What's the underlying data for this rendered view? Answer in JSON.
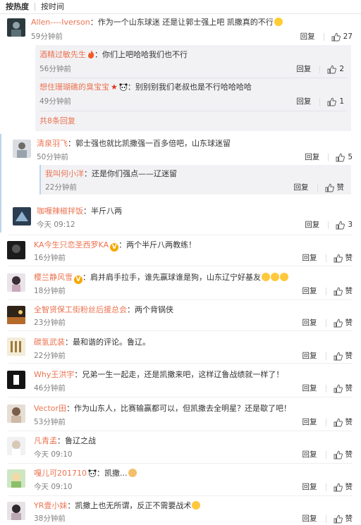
{
  "sort": {
    "hot": "按热度",
    "time": "按时间"
  },
  "labels": {
    "reply": "回复",
    "like": "赞"
  },
  "comments": [
    {
      "user": "Allen----Iverson",
      "text": "：作为一个山东球迷 还是让郭士强上吧 凯撒真的不行",
      "time": "59分钟前",
      "likes": "27",
      "replies": [
        {
          "user": "酒精过敏先生",
          "text": "：你们上吧哈哈我们也不行",
          "time": "56分钟前",
          "likes": "2"
        },
        {
          "user": "想住珊瑚礁的臭宝宝",
          "text": "：别别别我们老叔也是不行哈哈哈哈",
          "time": "49分钟前",
          "likes": "1"
        }
      ],
      "more": "共8条回复"
    },
    {
      "user": "清泉羽飞",
      "text": "：郭士强也就比凯撒强一百多倍吧，山东球迷留",
      "time": "50分钟前",
      "likes": "5",
      "replies": [
        {
          "user": "我叫何小洋",
          "text": "：还是你们强点——辽迷留",
          "time": "22分钟前",
          "likes": "赞"
        }
      ]
    },
    {
      "user": "咖喱辣椒拌饭",
      "text": "：半斤八两",
      "time": "今天 09:12",
      "likes": "3"
    },
    {
      "user": "KA今生只恋圣西罗KA",
      "text": "：两个半斤八两教练！",
      "time": "16分钟前",
      "likes": "赞"
    },
    {
      "user": "樱兰静风雪",
      "text": "：肩并肩手拉手，谁先赢球谁是狗，山东辽宁好基友",
      "time": "18分钟前",
      "likes": "赞"
    },
    {
      "user": "全智贤保工街粉丝后援总会",
      "text": "：两个背锅侠",
      "time": "23分钟前",
      "likes": "赞"
    },
    {
      "user": "碳氢武装",
      "text": "：最和谐的评论。鲁辽。",
      "time": "22分钟前",
      "likes": "赞"
    },
    {
      "user": "Why王洪宇",
      "text": "：兄弟一生一起走，还是凯撒来吧，这样辽鲁战绩就一样了！",
      "time": "46分钟前",
      "likes": "赞"
    },
    {
      "user": "Vector田",
      "text": "：作为山东人，比赛输赢都可以，但凯撒去全明星？还是歇了吧！",
      "time": "53分钟前",
      "likes": "赞"
    },
    {
      "user": "凡青孟",
      "text": "：鲁辽之战",
      "time": "今天 09:10",
      "likes": "赞"
    },
    {
      "user": "嘎儿可201710",
      "text": "：凯撒...",
      "time": "今天 09:10",
      "likes": "赞"
    },
    {
      "user": "YR壹小妹",
      "text": "：凯撒上也无所谓，反正不需要战术",
      "time": "38分钟前",
      "likes": "赞"
    }
  ]
}
